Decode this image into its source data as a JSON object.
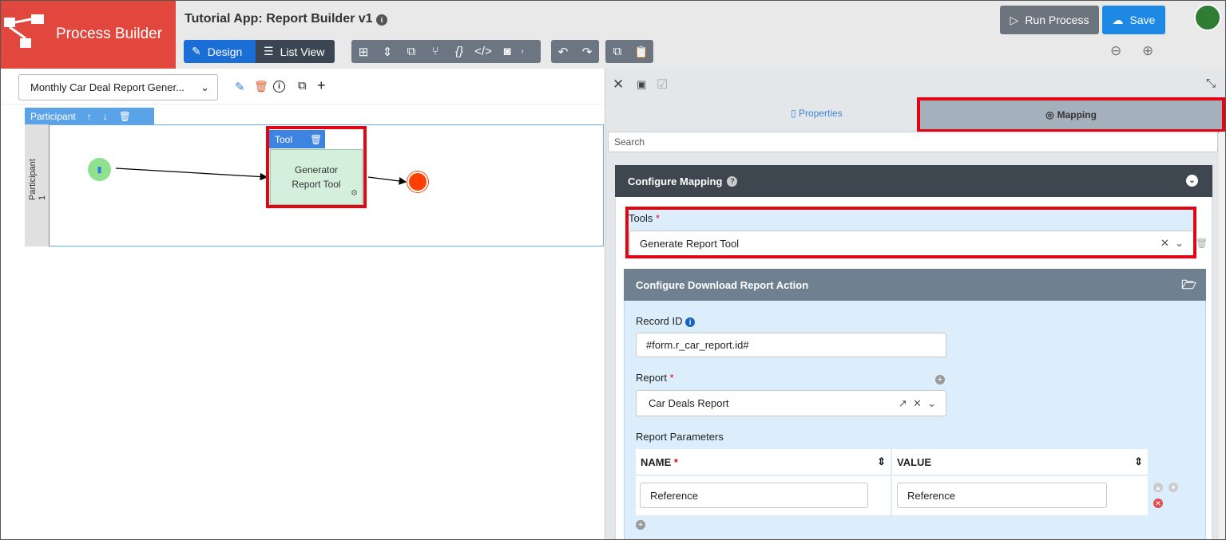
{
  "brand": {
    "title": "Process Builder"
  },
  "header": {
    "app_title": "Tutorial App: Report Builder v1",
    "design_label": "Design",
    "list_view_label": "List View",
    "run_label": "Run Process",
    "save_label": "Save"
  },
  "canvas": {
    "process_select": "Monthly Car Deal Report Gener...",
    "participant_tab": "Participant",
    "lane_label": "Participant 1",
    "tool_header": "Tool",
    "tool_name": "Generator Report Tool"
  },
  "panel": {
    "tab_properties": "Properties",
    "tab_mapping": "Mapping",
    "search_placeholder": "Search",
    "configure_mapping": "Configure Mapping",
    "tools_label": "Tools",
    "tools_value": "Generate Report Tool",
    "download_action": "Configure Download Report Action",
    "record_id_label": "Record ID",
    "record_id_value": "#form.r_car_report.id#",
    "report_label": "Report",
    "report_value": "Car Deals Report",
    "params_label": "Report Parameters",
    "col_name": "NAME",
    "col_value": "VALUE",
    "row_name": "Reference",
    "row_value": "Reference"
  },
  "colors": {
    "brand": "#e1473c",
    "primary": "#1b6ed6",
    "highlight": "#e20613"
  }
}
